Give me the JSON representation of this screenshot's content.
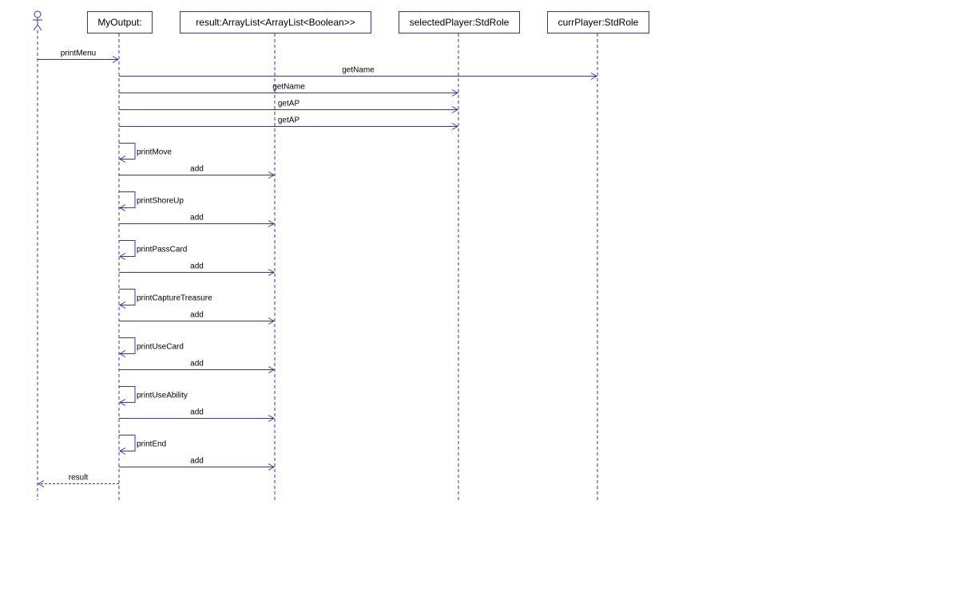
{
  "colors": {
    "line": "#3333aa",
    "box_border": "#3333aa",
    "box_fill": "#ffffff",
    "text": "#000000",
    "background": "#ffffff"
  },
  "participants": [
    {
      "id": "actor",
      "kind": "actor",
      "label": ""
    },
    {
      "id": "myoutput",
      "kind": "object",
      "label": "MyOutput:"
    },
    {
      "id": "result",
      "kind": "object",
      "label": "result:ArrayList<ArrayList<Boolean>>"
    },
    {
      "id": "selected",
      "kind": "object",
      "label": "selectedPlayer:StdRole"
    },
    {
      "id": "curr",
      "kind": "object",
      "label": "currPlayer:StdRole"
    }
  ],
  "messages": [
    {
      "from": "actor",
      "to": "myoutput",
      "label": "printMenu",
      "kind": "call"
    },
    {
      "from": "myoutput",
      "to": "curr",
      "label": "getName",
      "kind": "call"
    },
    {
      "from": "myoutput",
      "to": "selected",
      "label": "getName",
      "kind": "call"
    },
    {
      "from": "myoutput",
      "to": "selected",
      "label": "getAP",
      "kind": "call"
    },
    {
      "from": "myoutput",
      "to": "selected",
      "label": "getAP",
      "kind": "call"
    },
    {
      "from": "myoutput",
      "to": "myoutput",
      "label": "printMove",
      "kind": "self"
    },
    {
      "from": "myoutput",
      "to": "result",
      "label": "add",
      "kind": "call"
    },
    {
      "from": "myoutput",
      "to": "myoutput",
      "label": "printShoreUp",
      "kind": "self"
    },
    {
      "from": "myoutput",
      "to": "result",
      "label": "add",
      "kind": "call"
    },
    {
      "from": "myoutput",
      "to": "myoutput",
      "label": "printPassCard",
      "kind": "self"
    },
    {
      "from": "myoutput",
      "to": "result",
      "label": "add",
      "kind": "call"
    },
    {
      "from": "myoutput",
      "to": "myoutput",
      "label": "printCaptureTreasure",
      "kind": "self"
    },
    {
      "from": "myoutput",
      "to": "result",
      "label": "add",
      "kind": "call"
    },
    {
      "from": "myoutput",
      "to": "myoutput",
      "label": "printUseCard",
      "kind": "self"
    },
    {
      "from": "myoutput",
      "to": "result",
      "label": "add",
      "kind": "call"
    },
    {
      "from": "myoutput",
      "to": "myoutput",
      "label": "printUseAbility",
      "kind": "self"
    },
    {
      "from": "myoutput",
      "to": "result",
      "label": "add",
      "kind": "call"
    },
    {
      "from": "myoutput",
      "to": "myoutput",
      "label": "printEnd",
      "kind": "self"
    },
    {
      "from": "myoutput",
      "to": "result",
      "label": "add",
      "kind": "call"
    },
    {
      "from": "myoutput",
      "to": "actor",
      "label": "result",
      "kind": "return"
    }
  ]
}
